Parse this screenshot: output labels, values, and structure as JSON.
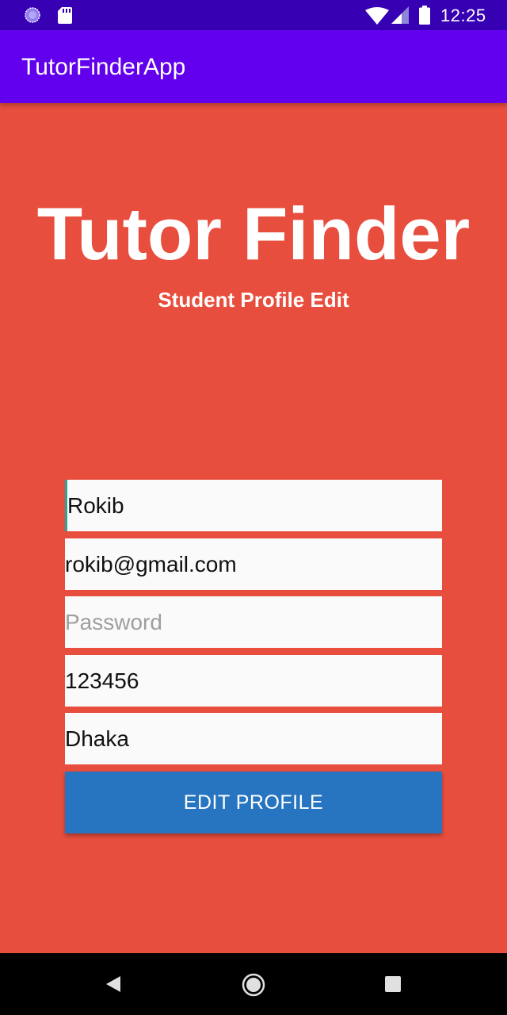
{
  "status_bar": {
    "time": "12:25",
    "icons": [
      "loading-icon",
      "sd-card-icon",
      "wifi-icon",
      "signal-icon",
      "battery-icon"
    ]
  },
  "app_bar": {
    "title": "TutorFinderApp"
  },
  "header": {
    "title": "Tutor Finder",
    "subtitle": "Student Profile Edit"
  },
  "form": {
    "name_value": "Rokib",
    "email_value": "rokib@gmail.com",
    "password_value": "",
    "password_placeholder": "Password",
    "phone_value": "123456",
    "location_value": "Dhaka",
    "submit_label": "EDIT PROFILE"
  },
  "nav_bar": {
    "icons": [
      "back-icon",
      "home-icon",
      "recents-icon"
    ]
  },
  "colors": {
    "background": "#E84E3E",
    "status_bar": "#3700B3",
    "app_bar": "#6200EE",
    "button": "#2775C0",
    "field": "#FAFAFA"
  }
}
